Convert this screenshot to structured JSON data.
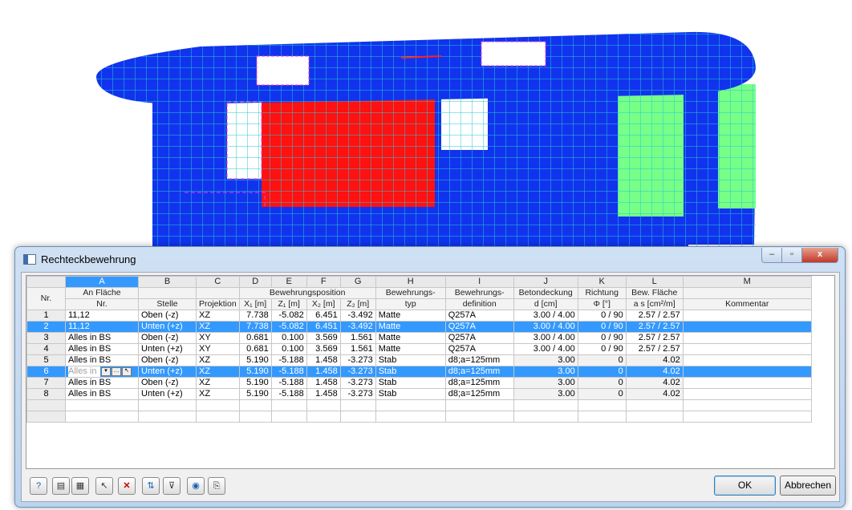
{
  "dialog": {
    "title": "Rechteckbewehrung",
    "window_controls": {
      "minimize": "–",
      "maximize": "▫",
      "close": "x"
    }
  },
  "table": {
    "column_letters": [
      "A",
      "B",
      "C",
      "D",
      "E",
      "F",
      "G",
      "H",
      "I",
      "J",
      "K",
      "L",
      "M"
    ],
    "header_row1": {
      "nr": "Nr.",
      "a_line1": "An Fläche",
      "position_group": "Bewehrungsposition",
      "h_line1": "Bewehrungs-",
      "i_line1": "Bewehrungs-",
      "j_line1": "Betondeckung",
      "k_line1": "Richtung",
      "l_line1": "Bew. Fläche"
    },
    "header_row2": {
      "a_line2": "Nr.",
      "b": "Stelle",
      "c": "Projektion",
      "d": "X₁ [m]",
      "e": "Z₁ [m]",
      "f": "X₂ [m]",
      "g": "Z₂ [m]",
      "h_line2": "typ",
      "i_line2": "definition",
      "j_line2": "d [cm]",
      "k_line2": "Φ [°]",
      "l_line2": "a s [cm²/m]",
      "m": "Kommentar"
    },
    "rows": [
      {
        "nr": "1",
        "a": "11,12",
        "b": "Oben (-z)",
        "c": "XZ",
        "d": "7.738",
        "e": "-5.082",
        "f": "6.451",
        "g": "-3.492",
        "h": "Matte",
        "i": "Q257A",
        "j": "3.00 / 4.00",
        "k": "0 / 90",
        "l": "2.57 / 2.57",
        "m": ""
      },
      {
        "nr": "2",
        "a": "11,12",
        "b": "Unten (+z)",
        "c": "XZ",
        "d": "7.738",
        "e": "-5.082",
        "f": "6.451",
        "g": "-3.492",
        "h": "Matte",
        "i": "Q257A",
        "j": "3.00 / 4.00",
        "k": "0 / 90",
        "l": "2.57 / 2.57",
        "m": ""
      },
      {
        "nr": "3",
        "a": "Alles in BS",
        "b": "Oben (-z)",
        "c": "XY",
        "d": "0.681",
        "e": "0.100",
        "f": "3.569",
        "g": "1.561",
        "h": "Matte",
        "i": "Q257A",
        "j": "3.00 / 4.00",
        "k": "0 / 90",
        "l": "2.57 / 2.57",
        "m": ""
      },
      {
        "nr": "4",
        "a": "Alles in BS",
        "b": "Unten (+z)",
        "c": "XY",
        "d": "0.681",
        "e": "0.100",
        "f": "3.569",
        "g": "1.561",
        "h": "Matte",
        "i": "Q257A",
        "j": "3.00 / 4.00",
        "k": "0 / 90",
        "l": "2.57 / 2.57",
        "m": ""
      },
      {
        "nr": "5",
        "a": "Alles in BS",
        "b": "Oben (-z)",
        "c": "XZ",
        "d": "5.190",
        "e": "-5.188",
        "f": "1.458",
        "g": "-3.273",
        "h": "Stab",
        "i": "d8;a=125mm",
        "j": "3.00",
        "k": "0",
        "l": "4.02",
        "m": ""
      },
      {
        "nr": "6",
        "a": "Alles in",
        "b": "Unten (+z)",
        "c": "XZ",
        "d": "5.190",
        "e": "-5.188",
        "f": "1.458",
        "g": "-3.273",
        "h": "Stab",
        "i": "d8;a=125mm",
        "j": "3.00",
        "k": "0",
        "l": "4.02",
        "m": ""
      },
      {
        "nr": "7",
        "a": "Alles in BS",
        "b": "Oben (-z)",
        "c": "XZ",
        "d": "5.190",
        "e": "-5.188",
        "f": "1.458",
        "g": "-3.273",
        "h": "Stab",
        "i": "d8;a=125mm",
        "j": "3.00",
        "k": "0",
        "l": "4.02",
        "m": ""
      },
      {
        "nr": "8",
        "a": "Alles in BS",
        "b": "Unten (+z)",
        "c": "XZ",
        "d": "5.190",
        "e": "-5.188",
        "f": "1.458",
        "g": "-3.273",
        "h": "Stab",
        "i": "d8;a=125mm",
        "j": "3.00",
        "k": "0",
        "l": "4.02",
        "m": ""
      }
    ],
    "selected_rows": [
      "2",
      "6"
    ]
  },
  "toolbar": {
    "icons": [
      "help-icon",
      "new-row-icon",
      "import-icon",
      "select-icon",
      "delete-icon",
      "sort-icon",
      "filter-icon",
      "view-icon",
      "export-icon"
    ]
  },
  "buttons": {
    "ok": "OK",
    "cancel": "Abbrechen"
  },
  "colors": {
    "selection": "#3399ff",
    "mesh_blue": "#1133ee",
    "mesh_red": "#ff1111",
    "mesh_green": "#77ff88",
    "grid_line": "#2ad4d4"
  }
}
